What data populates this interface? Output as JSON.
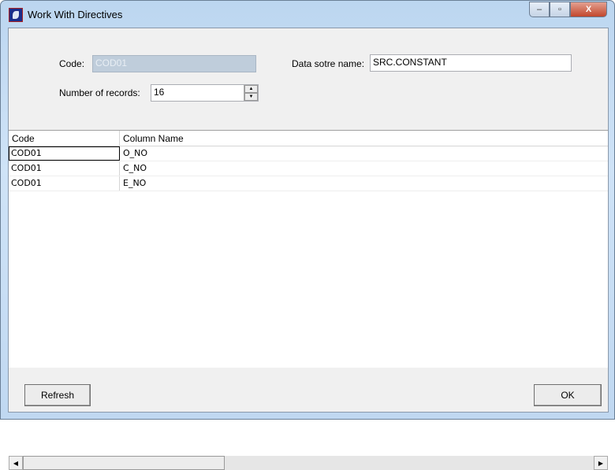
{
  "window": {
    "title": "Work With Directives",
    "icon": "app-icon",
    "controls": {
      "minimize": "–",
      "maximize": "▫",
      "close": "X"
    }
  },
  "form": {
    "code_label": "Code:",
    "code_value": "COD01",
    "datastore_label": "Data sotre name:",
    "datastore_value": "SRC.CONSTANT",
    "records_label": "Number of records:",
    "records_value": "16"
  },
  "grid": {
    "columns": [
      "Code",
      "Column Name"
    ],
    "rows": [
      [
        "COD01",
        "O_NO"
      ],
      [
        "COD01",
        "C_NO"
      ],
      [
        "COD01",
        "E_NO"
      ]
    ]
  },
  "buttons": {
    "refresh": "Refresh",
    "ok": "OK"
  },
  "colors": {
    "disabled_field": "#bfcddb",
    "disabled_text": "#e8eef4"
  }
}
